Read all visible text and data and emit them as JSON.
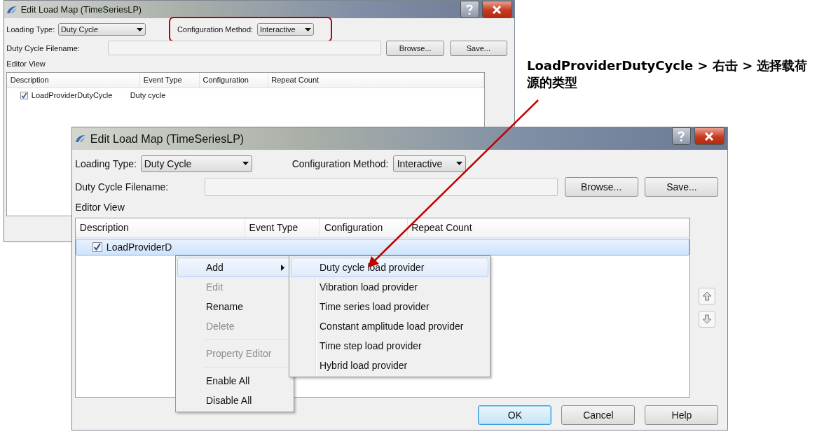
{
  "windows": [
    {
      "title": "Edit Load Map (TimeSeriesLP)",
      "loading_type": {
        "label": "Loading Type:",
        "value": "Duty Cycle"
      },
      "configuration_method": {
        "label": "Configuration Method:",
        "value": "Interactive",
        "highlighted": true
      },
      "filename": {
        "label": "Duty Cycle Filename:"
      },
      "buttons": [
        "Browse...",
        "Save..."
      ],
      "editor_label": "Editor View",
      "table": {
        "columns": [
          "Description",
          "Event Type",
          "Configuration",
          "Repeat Count"
        ],
        "rows": [
          {
            "checked": true,
            "selected": false,
            "cells": [
              "LoadProviderDutyCycle",
              "Duty cycle"
            ]
          }
        ]
      }
    },
    {
      "title": "Edit Load Map (TimeSeriesLP)",
      "loading_type": {
        "label": "Loading Type:",
        "value": "Duty Cycle"
      },
      "configuration_method": {
        "label": "Configuration Method:",
        "value": "Interactive"
      },
      "filename": {
        "label": "Duty Cycle Filename:"
      },
      "buttons": [
        "Browse...",
        "Save..."
      ],
      "editor_label": "Editor View",
      "table": {
        "columns": [
          "Description",
          "Event Type",
          "Configuration",
          "Repeat Count"
        ],
        "rows": [
          {
            "checked": true,
            "selected": true,
            "cells": [
              "LoadProviderD"
            ]
          }
        ]
      },
      "move_buttons": true,
      "footer_buttons": [
        {
          "label": "OK",
          "default": true
        },
        {
          "label": "Cancel",
          "default": false
        },
        {
          "label": "Help",
          "default": false
        }
      ]
    }
  ],
  "context_menu": {
    "items": [
      {
        "kind": "submenu",
        "label": "Add",
        "highlighted": true,
        "disabled": false
      },
      {
        "kind": "item",
        "label": "Edit",
        "highlighted": false,
        "disabled": true
      },
      {
        "kind": "item",
        "label": "Rename",
        "highlighted": false,
        "disabled": false
      },
      {
        "kind": "item",
        "label": "Delete",
        "highlighted": false,
        "disabled": true
      },
      {
        "kind": "separator"
      },
      {
        "kind": "item",
        "label": "Property Editor",
        "highlighted": false,
        "disabled": true
      },
      {
        "kind": "separator"
      },
      {
        "kind": "item",
        "label": "Enable All",
        "highlighted": false,
        "disabled": false
      },
      {
        "kind": "item",
        "label": "Disable All",
        "highlighted": false,
        "disabled": false
      }
    ]
  },
  "submenu": {
    "items": [
      {
        "label": "Duty cycle load provider",
        "highlighted": true
      },
      {
        "label": "Vibration load provider",
        "highlighted": false
      },
      {
        "label": "Time series load provider",
        "highlighted": false
      },
      {
        "label": "Constant amplitude load provider",
        "highlighted": false
      },
      {
        "label": "Time step load provider",
        "highlighted": false
      },
      {
        "label": "Hybrid load provider",
        "highlighted": false
      }
    ]
  },
  "annotation": {
    "text": "LoadProviderDutyCycle > 右击 > 选择载荷源的类型"
  }
}
